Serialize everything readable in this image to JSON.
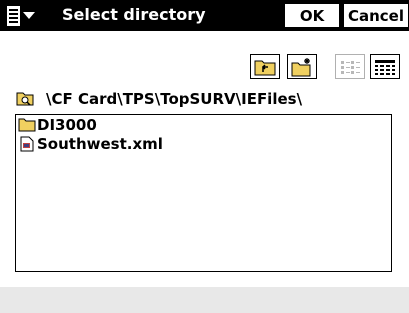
{
  "header": {
    "title": "Select directory",
    "ok_label": "OK",
    "cancel_label": "Cancel",
    "menu_icon": "menu-list-icon",
    "menu_caret": "chevron-down-icon"
  },
  "toolbar": {
    "buttons": [
      {
        "icon": "folder-up-icon"
      },
      {
        "icon": "new-folder-icon"
      },
      {
        "icon": "list-view-icon"
      },
      {
        "icon": "details-view-icon"
      }
    ]
  },
  "path": {
    "text": "\\CF Card\\TPS\\TopSURV\\IEFiles\\",
    "icon": "folder-open-icon"
  },
  "files": [
    {
      "name": "DI3000",
      "icon": "folder-icon"
    },
    {
      "name": "Southwest.xml",
      "icon": "xml-file-icon"
    }
  ],
  "colors": {
    "titlebar": "#000000",
    "folder": "#f0d060",
    "bottom_bar": "#e8e8e8"
  }
}
